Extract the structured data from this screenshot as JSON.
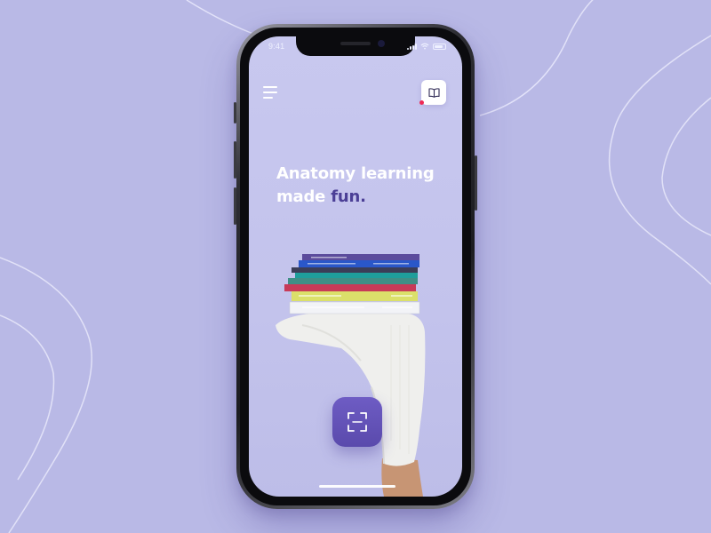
{
  "status_bar": {
    "time": "9:41"
  },
  "header": {
    "menu_icon": "hamburger-menu-icon",
    "library_icon": "book-icon",
    "notification_color": "#ee2a56"
  },
  "hero": {
    "headline_line1": "Anatomy learning",
    "headline_line2": "made",
    "headline_accent": "fun.",
    "accent_color": "#4b3f96"
  },
  "actions": {
    "scan_icon": "scan-frame-icon"
  },
  "colors": {
    "background": "#b9b9e6",
    "screen": "#c6c6ee",
    "primary": "#5f4db4"
  }
}
